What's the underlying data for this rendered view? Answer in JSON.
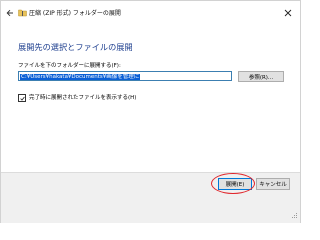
{
  "window": {
    "title": "圧縮 (ZIP 形式) フォルダーの展開"
  },
  "main": {
    "heading": "展開先の選択とファイルの展開",
    "destination_label": "ファイルを下のフォルダーに展開する(F):",
    "destination_value": "C:¥Users¥hakata¥Documents¥画像を管理に",
    "browse_label": "参照(R)...",
    "show_files_label": "完了時に展開されたファイルを表示する(H)",
    "show_files_checked": true
  },
  "footer": {
    "extract_label": "展開(E)",
    "cancel_label": "キャンセル"
  },
  "icons": {
    "back": "back-arrow-icon",
    "zip": "zip-folder-icon",
    "close": "close-icon",
    "check": "checkmark-icon",
    "grip": "resize-grip-icon"
  },
  "colors": {
    "heading": "#1e3f8f",
    "selection": "#0a5fd6",
    "highlight_ring": "#e0242a",
    "footer_bg": "#f0f0f0"
  }
}
